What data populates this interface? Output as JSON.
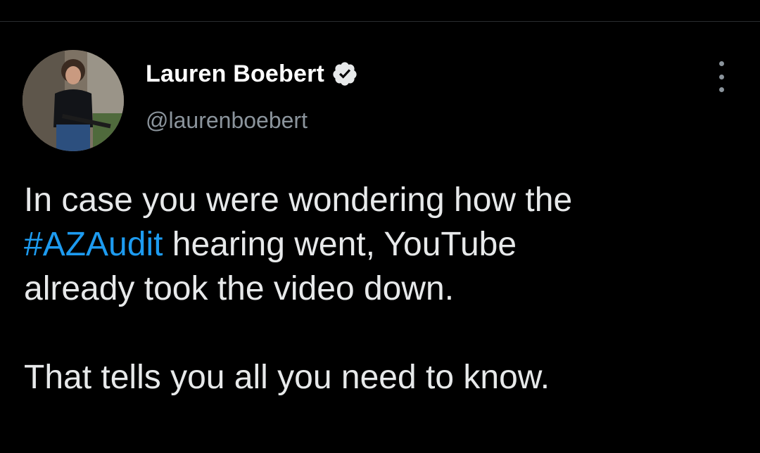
{
  "author": {
    "display_name": "Lauren Boebert",
    "handle": "@laurenboebert",
    "verified": true,
    "avatar_icon": "profile-photo"
  },
  "tweet": {
    "line1": "In case you were wondering how the",
    "hashtag": "#AZAudit",
    "line2_rest": " hearing went, YouTube",
    "line3": "already took the video down.",
    "line4": "That tells you all you need to know."
  },
  "icons": {
    "verified": "verified-badge-icon",
    "more": "more-options-icon"
  },
  "colors": {
    "background": "#000000",
    "text": "#e7e9ea",
    "secondary_text": "#8b949c",
    "link": "#1d9bf0"
  }
}
